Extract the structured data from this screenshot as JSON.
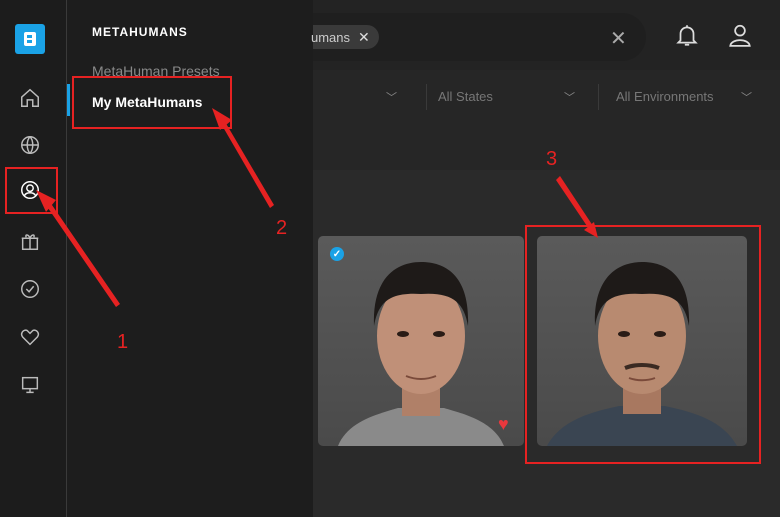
{
  "flyout": {
    "title": "METAHUMANS",
    "items": [
      "MetaHuman Presets",
      "My MetaHumans"
    ]
  },
  "search": {
    "chip_label": "umans",
    "chip_close": "✕",
    "clear": "✕"
  },
  "filters": {
    "states": "All States",
    "environments": "All Environments"
  },
  "annotations": {
    "labels": [
      "1",
      "2",
      "3"
    ],
    "color": "#e62222"
  },
  "icons": {
    "rail": [
      "logo-icon",
      "home-icon",
      "globe-icon",
      "user-icon",
      "gift-icon",
      "check-circle-icon",
      "heart-icon",
      "monitor-icon"
    ],
    "top": [
      "bell-icon",
      "account-icon"
    ]
  },
  "colors": {
    "accent": "#1aa2e6",
    "favorite": "#e8383d"
  }
}
